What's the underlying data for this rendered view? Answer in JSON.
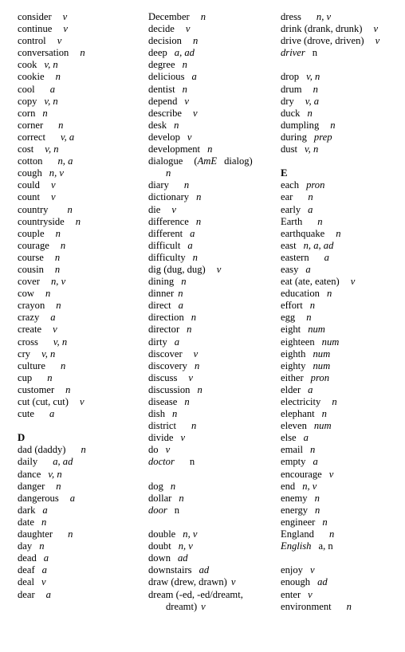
{
  "document": {
    "title": "Vocabulary Word List C-E",
    "background_color": "#ffffff",
    "text_color": "#000000"
  },
  "columns": [
    {
      "id": "column-1",
      "lines": [
        {
          "type": "entry",
          "word": "consider",
          "pos": "v",
          "gap": 3
        },
        {
          "type": "entry",
          "word": "continue",
          "pos": "v",
          "gap": 3
        },
        {
          "type": "entry",
          "word": "control",
          "pos": "v",
          "gap": 3
        },
        {
          "type": "entry",
          "word": "conversation",
          "pos": "n",
          "gap": 3
        },
        {
          "type": "entry",
          "word": "cook",
          "pos": "v, n",
          "gap": 2
        },
        {
          "type": "entry",
          "word": "cookie",
          "pos": "n",
          "gap": 3
        },
        {
          "type": "entry",
          "word": "cool",
          "pos": "a",
          "gap": 4
        },
        {
          "type": "entry",
          "word": "copy",
          "pos": "v, n",
          "gap": 2
        },
        {
          "type": "entry",
          "word": "corn",
          "pos": "n",
          "gap": 2
        },
        {
          "type": "entry",
          "word": "corner",
          "pos": "n",
          "gap": 4
        },
        {
          "type": "entry",
          "word": "correct",
          "pos": "v, a",
          "gap": 4
        },
        {
          "type": "entry",
          "word": "cost",
          "pos": "v, n",
          "gap": 3
        },
        {
          "type": "entry",
          "word": "cotton",
          "pos": "n, a",
          "gap": 4
        },
        {
          "type": "entry",
          "word": "cough",
          "pos": "n, v",
          "gap": 2
        },
        {
          "type": "entry",
          "word": "could",
          "pos": "v",
          "gap": 3
        },
        {
          "type": "entry",
          "word": "count",
          "pos": "v",
          "gap": 3
        },
        {
          "type": "entry",
          "word": "country",
          "pos": "n",
          "gap": 5
        },
        {
          "type": "entry",
          "word": "countryside",
          "pos": "n",
          "gap": 3
        },
        {
          "type": "entry",
          "word": "couple",
          "pos": "n",
          "gap": 3
        },
        {
          "type": "entry",
          "word": "courage",
          "pos": "n",
          "gap": 3
        },
        {
          "type": "entry",
          "word": "course",
          "pos": "n",
          "gap": 3
        },
        {
          "type": "entry",
          "word": "cousin",
          "pos": "n",
          "gap": 3
        },
        {
          "type": "entry",
          "word": "cover",
          "pos": "n, v",
          "gap": 3
        },
        {
          "type": "entry",
          "word": "cow",
          "pos": "n",
          "gap": 3
        },
        {
          "type": "entry",
          "word": "crayon",
          "pos": "n",
          "gap": 3
        },
        {
          "type": "entry",
          "word": "crazy",
          "pos": "a",
          "gap": 3
        },
        {
          "type": "entry",
          "word": "create",
          "pos": "v",
          "gap": 3
        },
        {
          "type": "entry",
          "word": "cross",
          "pos": "v, n",
          "gap": 4
        },
        {
          "type": "entry",
          "word": "cry",
          "pos": "v, n",
          "gap": 3
        },
        {
          "type": "entry",
          "word": "culture",
          "pos": "n",
          "gap": 4
        },
        {
          "type": "entry",
          "word": "cup",
          "pos": "n",
          "gap": 4
        },
        {
          "type": "entry",
          "word": "customer",
          "pos": "n",
          "gap": 3
        },
        {
          "type": "entry",
          "word": "cut (cut, cut)",
          "pos": "v",
          "gap": 3
        },
        {
          "type": "entry",
          "word": "cute",
          "pos": "a",
          "gap": 4
        },
        {
          "type": "gap"
        },
        {
          "type": "section",
          "letter": "D"
        },
        {
          "type": "entry",
          "word": "dad (daddy)",
          "pos": "n",
          "gap": 4
        },
        {
          "type": "entry",
          "word": "daily",
          "pos": "a, ad",
          "gap": 4
        },
        {
          "type": "entry",
          "word": "dance",
          "pos": "v, n",
          "gap": 2
        },
        {
          "type": "entry",
          "word": "danger",
          "pos": "n",
          "gap": 3
        },
        {
          "type": "entry",
          "word": "dangerous",
          "pos": "a",
          "gap": 3
        },
        {
          "type": "entry",
          "word": "dark",
          "pos": "a",
          "gap": 2
        },
        {
          "type": "entry",
          "word": "date",
          "pos": "n",
          "gap": 2
        },
        {
          "type": "entry",
          "word": "daughter",
          "pos": "n",
          "gap": 4
        },
        {
          "type": "entry",
          "word": "day",
          "pos": "n",
          "gap": 2
        },
        {
          "type": "entry",
          "word": "dead",
          "pos": "a",
          "gap": 2
        },
        {
          "type": "entry",
          "word": "deaf",
          "pos": "a",
          "gap": 2
        },
        {
          "type": "entry",
          "word": "deal",
          "pos": "v",
          "gap": 2
        },
        {
          "type": "entry",
          "word": "dear",
          "pos": "a",
          "gap": 3
        }
      ]
    },
    {
      "id": "column-2",
      "lines": [
        {
          "type": "entry",
          "word": "December",
          "pos": "n",
          "gap": 3
        },
        {
          "type": "entry",
          "word": "decide",
          "pos": "v",
          "gap": 3
        },
        {
          "type": "entry",
          "word": "decision",
          "pos": "n",
          "gap": 3
        },
        {
          "type": "entry",
          "word": "deep",
          "pos": "a, ad",
          "gap": 2
        },
        {
          "type": "entry",
          "word": "degree",
          "pos": "n",
          "gap": 2
        },
        {
          "type": "entry",
          "word": "delicious",
          "pos": "a",
          "gap": 2
        },
        {
          "type": "entry",
          "word": "dentist",
          "pos": "n",
          "gap": 2
        },
        {
          "type": "entry",
          "word": "depend",
          "pos": "v",
          "gap": 2
        },
        {
          "type": "entry",
          "word": "describe",
          "pos": "v",
          "gap": 3
        },
        {
          "type": "entry",
          "word": "desk",
          "pos": "n",
          "gap": 2
        },
        {
          "type": "entry",
          "word": "develop",
          "pos": "v",
          "gap": 2
        },
        {
          "type": "entry",
          "word": "development",
          "pos": "n",
          "gap": 2
        },
        {
          "type": "wrap",
          "word": "dialogue",
          "paren_prefix": "(",
          "italic_part": "AmE",
          "rest": "dialog)",
          "pos": "n"
        },
        {
          "type": "entry",
          "word": "diary",
          "pos": "n",
          "gap": 4
        },
        {
          "type": "entry",
          "word": "dictionary",
          "pos": "n",
          "gap": 2
        },
        {
          "type": "entry",
          "word": "die",
          "pos": "v",
          "gap": 3
        },
        {
          "type": "entry",
          "word": "difference",
          "pos": "n",
          "gap": 2
        },
        {
          "type": "entry",
          "word": "different",
          "pos": "a",
          "gap": 2
        },
        {
          "type": "entry",
          "word": "difficult",
          "pos": "a",
          "gap": 2
        },
        {
          "type": "entry",
          "word": "difficulty",
          "pos": "n",
          "gap": 2
        },
        {
          "type": "entry",
          "word": "dig (dug, dug)",
          "pos": "v",
          "gap": 3
        },
        {
          "type": "entry",
          "word": "dining",
          "pos": "n",
          "gap": 2
        },
        {
          "type": "entry",
          "word": "dinner",
          "pos": "n",
          "gap": 1
        },
        {
          "type": "entry",
          "word": "direct",
          "pos": "a",
          "gap": 2
        },
        {
          "type": "entry",
          "word": "direction",
          "pos": "n",
          "gap": 2
        },
        {
          "type": "entry",
          "word": "director",
          "pos": "n",
          "gap": 2
        },
        {
          "type": "entry",
          "word": "dirty",
          "pos": "a",
          "gap": 2
        },
        {
          "type": "entry",
          "word": "discover",
          "pos": "v",
          "gap": 3
        },
        {
          "type": "entry",
          "word": "discovery",
          "pos": "n",
          "gap": 2
        },
        {
          "type": "entry",
          "word": "discuss",
          "pos": "v",
          "gap": 3
        },
        {
          "type": "entry",
          "word": "discussion",
          "pos": "n",
          "gap": 2
        },
        {
          "type": "entry",
          "word": "disease",
          "pos": "n",
          "gap": 2
        },
        {
          "type": "entry",
          "word": "dish",
          "pos": "n",
          "gap": 2
        },
        {
          "type": "entry",
          "word": "district",
          "pos": "n",
          "gap": 4
        },
        {
          "type": "entry",
          "word": "divide",
          "pos": "v",
          "gap": 2
        },
        {
          "type": "entry",
          "word": "do",
          "pos": "v",
          "gap": 2
        },
        {
          "type": "entry",
          "word": "doctor",
          "pos": "n",
          "gap": 4,
          "word_italic": true,
          "pos_upright": true
        },
        {
          "type": "gap"
        },
        {
          "type": "entry",
          "word": "dog",
          "pos": "n",
          "gap": 2
        },
        {
          "type": "entry",
          "word": "dollar",
          "pos": "n",
          "gap": 2
        },
        {
          "type": "entry",
          "word": "door",
          "pos": "n",
          "gap": 2,
          "word_italic": true,
          "pos_upright": true
        },
        {
          "type": "gap"
        },
        {
          "type": "entry",
          "word": "double",
          "pos": "n, v",
          "gap": 2
        },
        {
          "type": "entry",
          "word": "doubt",
          "pos": "n, v",
          "gap": 2
        },
        {
          "type": "entry",
          "word": "down",
          "pos": "ad",
          "gap": 2
        },
        {
          "type": "entry",
          "word": "downstairs",
          "pos": "ad",
          "gap": 2
        },
        {
          "type": "entry",
          "word": "draw (drew, drawn)",
          "pos": "v",
          "gap": 1
        },
        {
          "type": "wrap2",
          "line1": "dream (-ed, -ed/dreamt,",
          "line2": "dreamt)",
          "pos": "v"
        }
      ]
    },
    {
      "id": "column-3",
      "lines": [
        {
          "type": "entry",
          "word": "dress",
          "pos": "n, v",
          "gap": 4
        },
        {
          "type": "entry",
          "word": "drink (drank, drunk)",
          "pos": "v",
          "gap": 3
        },
        {
          "type": "entry",
          "word": "drive (drove, driven)",
          "pos": "v",
          "gap": 3
        },
        {
          "type": "entry",
          "word": "driver",
          "pos": "n",
          "gap": 2,
          "word_italic": true,
          "pos_upright": true
        },
        {
          "type": "gap"
        },
        {
          "type": "entry",
          "word": "drop",
          "pos": "v, n",
          "gap": 2
        },
        {
          "type": "entry",
          "word": "drum",
          "pos": "n",
          "gap": 3
        },
        {
          "type": "entry",
          "word": "dry",
          "pos": "v, a",
          "gap": 3
        },
        {
          "type": "entry",
          "word": "duck",
          "pos": "n",
          "gap": 2
        },
        {
          "type": "entry",
          "word": "dumpling",
          "pos": "n",
          "gap": 3
        },
        {
          "type": "entry",
          "word": "during",
          "pos": "prep",
          "gap": 2
        },
        {
          "type": "entry",
          "word": "dust",
          "pos": "v, n",
          "gap": 2
        },
        {
          "type": "gap"
        },
        {
          "type": "section",
          "letter": "E"
        },
        {
          "type": "entry",
          "word": "each",
          "pos": "pron",
          "gap": 2
        },
        {
          "type": "entry",
          "word": "ear",
          "pos": "n",
          "gap": 4
        },
        {
          "type": "entry",
          "word": "early",
          "pos": "a",
          "gap": 2
        },
        {
          "type": "entry",
          "word": "Earth",
          "pos": "n",
          "gap": 4
        },
        {
          "type": "entry",
          "word": "earthquake",
          "pos": "n",
          "gap": 3
        },
        {
          "type": "entry",
          "word": "east",
          "pos": "n, a, ad",
          "gap": 2
        },
        {
          "type": "entry",
          "word": "eastern",
          "pos": "a",
          "gap": 4
        },
        {
          "type": "entry",
          "word": "easy",
          "pos": "a",
          "gap": 2
        },
        {
          "type": "entry",
          "word": "eat (ate, eaten)",
          "pos": "v",
          "gap": 3
        },
        {
          "type": "entry",
          "word": "education",
          "pos": "n",
          "gap": 2
        },
        {
          "type": "entry",
          "word": "effort",
          "pos": "n",
          "gap": 2
        },
        {
          "type": "entry",
          "word": "egg",
          "pos": "n",
          "gap": 3
        },
        {
          "type": "entry",
          "word": "eight",
          "pos": "num",
          "gap": 2
        },
        {
          "type": "entry",
          "word": "eighteen",
          "pos": "num",
          "gap": 2
        },
        {
          "type": "entry",
          "word": "eighth",
          "pos": "num",
          "gap": 2
        },
        {
          "type": "entry",
          "word": "eighty",
          "pos": "num",
          "gap": 2
        },
        {
          "type": "entry",
          "word": "either",
          "pos": "pron",
          "gap": 2
        },
        {
          "type": "entry",
          "word": "elder",
          "pos": "a",
          "gap": 2
        },
        {
          "type": "entry",
          "word": "electricity",
          "pos": "n",
          "gap": 3
        },
        {
          "type": "entry",
          "word": "elephant",
          "pos": "n",
          "gap": 2
        },
        {
          "type": "entry",
          "word": "eleven",
          "pos": "num",
          "gap": 2
        },
        {
          "type": "entry",
          "word": "else",
          "pos": "a",
          "gap": 2
        },
        {
          "type": "entry",
          "word": "email",
          "pos": "n",
          "gap": 2
        },
        {
          "type": "entry",
          "word": "empty",
          "pos": "a",
          "gap": 2
        },
        {
          "type": "entry",
          "word": "encourage",
          "pos": "v",
          "gap": 2
        },
        {
          "type": "entry",
          "word": "end",
          "pos": "n, v",
          "gap": 2
        },
        {
          "type": "entry",
          "word": "enemy",
          "pos": "n",
          "gap": 2
        },
        {
          "type": "entry",
          "word": "energy",
          "pos": "n",
          "gap": 2
        },
        {
          "type": "entry",
          "word": "engineer",
          "pos": "n",
          "gap": 2
        },
        {
          "type": "entry",
          "word": "England",
          "pos": "n",
          "gap": 4
        },
        {
          "type": "entry",
          "word": "English",
          "pos": "a, n",
          "gap": 2,
          "word_italic": true,
          "pos_upright": true
        },
        {
          "type": "gap"
        },
        {
          "type": "entry",
          "word": "enjoy",
          "pos": "v",
          "gap": 2
        },
        {
          "type": "entry",
          "word": "enough",
          "pos": "ad",
          "gap": 2
        },
        {
          "type": "entry",
          "word": "enter",
          "pos": "v",
          "gap": 2
        },
        {
          "type": "entry",
          "word": "environment",
          "pos": "n",
          "gap": 4
        }
      ]
    }
  ]
}
